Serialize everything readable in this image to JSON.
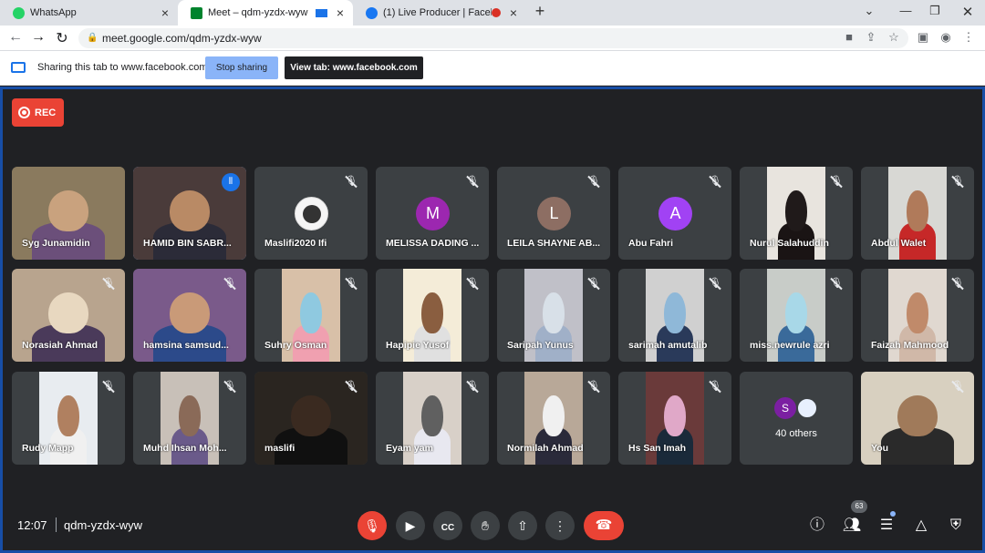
{
  "browser": {
    "tabs": [
      {
        "title": "WhatsApp",
        "favicon": "whatsapp-icon",
        "color": "#25d366"
      },
      {
        "title": "Meet – qdm-yzdx-wyw",
        "favicon": "google-meet-icon",
        "color": "#00832d"
      },
      {
        "title": "(1) Live Producer | Facebook",
        "favicon": "facebook-icon",
        "color": "#1877f2"
      }
    ],
    "url": "meet.google.com/qdm-yzdx-wyw"
  },
  "share_bar": {
    "text": "Sharing this tab to www.facebook.com",
    "stop_label": "Stop sharing",
    "view_label": "View tab: www.facebook.com"
  },
  "meeting": {
    "rec_label": "REC",
    "time": "12:07",
    "code": "qdm-yzdx-wyw",
    "participant_count": "63",
    "others_label": "40 others",
    "others_initial": "S",
    "participants": [
      {
        "name": "Syg Junamidin",
        "type": "video",
        "muted": false,
        "bg": "#8a7a5e",
        "skin": "#c9a27e",
        "cloth": "#6b4f7a"
      },
      {
        "name": "HAMID BIN SABR...",
        "type": "video",
        "muted": false,
        "speaking": true,
        "bg": "#4a3b3a",
        "skin": "#b98a65",
        "cloth": "#2b2b38"
      },
      {
        "name": "Maslifi2020 Ifi",
        "type": "avatar_img",
        "muted": true
      },
      {
        "name": "MELISSA DADING ...",
        "type": "initial",
        "initial": "M",
        "color": "#9c27b0",
        "muted": true
      },
      {
        "name": "LEILA SHAYNE AB...",
        "type": "initial",
        "initial": "L",
        "color": "#8d6e63",
        "muted": true
      },
      {
        "name": "Abu Fahri",
        "type": "initial",
        "initial": "A",
        "color": "#a142f4",
        "muted": true
      },
      {
        "name": "Nurul Salahuddin",
        "type": "video",
        "muted": true,
        "bg": "#e8e4de",
        "skin": "#201a1a",
        "cloth": "#1a1414"
      },
      {
        "name": "Abdul Walet",
        "type": "video",
        "muted": true,
        "bg": "#d8d8d4",
        "skin": "#b07a5a",
        "cloth": "#c62828"
      },
      {
        "name": "Norasiah Ahmad",
        "type": "video",
        "muted": true,
        "bg": "#b8a48e",
        "skin": "#e8d8c0",
        "cloth": "#4a3a5a"
      },
      {
        "name": "hamsina samsud...",
        "type": "video",
        "muted": true,
        "bg": "#7a5a8a",
        "skin": "#c99a78",
        "cloth": "#2c4a8a"
      },
      {
        "name": "Suhry Osman",
        "type": "video",
        "muted": true,
        "bg": "#d8c0a8",
        "skin": "#8fc9e0",
        "cloth": "#f0a0b0"
      },
      {
        "name": "Hapipie Yusof",
        "type": "video",
        "muted": true,
        "bg": "#f4ecd8",
        "skin": "#8a5e40",
        "cloth": "#e0e0e0"
      },
      {
        "name": "Saripah Yunus",
        "type": "video",
        "muted": true,
        "bg": "#c0c0c8",
        "skin": "#d8e0e8",
        "cloth": "#a0b0c8"
      },
      {
        "name": "sarimah amutalib",
        "type": "video",
        "muted": true,
        "bg": "#d0d0d0",
        "skin": "#8fb8d8",
        "cloth": "#2a3a5a"
      },
      {
        "name": "miss.newrule azri",
        "type": "video",
        "muted": true,
        "bg": "#c8ccc8",
        "skin": "#a8d8e8",
        "cloth": "#3a6a9a"
      },
      {
        "name": "Faizah Mahmood",
        "type": "video",
        "muted": true,
        "bg": "#e0d8d0",
        "skin": "#c08a6a",
        "cloth": "#d0b8a8"
      },
      {
        "name": "Rudy Mapp",
        "type": "video",
        "muted": true,
        "bg": "#e8ecf0",
        "skin": "#b08060",
        "cloth": "#f0f0f0"
      },
      {
        "name": "Muhd Ihsan Moh...",
        "type": "video",
        "muted": true,
        "bg": "#c8c0b8",
        "skin": "#8a6a58",
        "cloth": "#6a5a8a"
      },
      {
        "name": "maslifi",
        "type": "video",
        "muted": true,
        "bg": "#2a2520",
        "skin": "#3a2a20",
        "cloth": "#101010"
      },
      {
        "name": "Eyam yam",
        "type": "video",
        "muted": true,
        "bg": "#d8d0c8",
        "skin": "#606060",
        "cloth": "#e8e8f0"
      },
      {
        "name": "Normilah Ahmad",
        "type": "video",
        "muted": true,
        "bg": "#b8a898",
        "skin": "#f0f0f0",
        "cloth": "#2a2a3a"
      },
      {
        "name": "Hs San Imah",
        "type": "video",
        "muted": true,
        "bg": "#6a3a3a",
        "skin": "#e0a8c8",
        "cloth": "#1a2a3a"
      },
      {
        "name": "40 others",
        "type": "others"
      },
      {
        "name": "You",
        "type": "video",
        "muted": true,
        "bg": "#d8d0c0",
        "skin": "#a07a5a",
        "cloth": "#2a2a2a"
      }
    ]
  }
}
